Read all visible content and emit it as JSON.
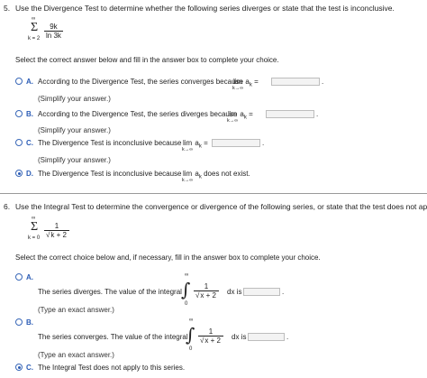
{
  "q5": {
    "number": "5.",
    "prompt": "Use the Divergence Test to determine whether the following series diverges or state that the test is inconclusive.",
    "series": {
      "sigma": "Σ",
      "upper": "∞",
      "lower": "k = 2",
      "numerator": "9k",
      "denominator": "ln 3k"
    },
    "instruction": "Select the correct answer below and fill in the answer box to complete your choice.",
    "options": [
      {
        "letter": "A.",
        "text": "According to the Divergence Test, the series converges because",
        "lim": "lim",
        "sub": "k→∞",
        "a": "a",
        "ak_sub": "k",
        "eq": "=",
        "hint": "(Simplify your answer.)",
        "selected": false
      },
      {
        "letter": "B.",
        "text": "According to the Divergence Test, the series diverges because",
        "lim": "lim",
        "sub": "k→∞",
        "a": "a",
        "ak_sub": "k",
        "eq": "=",
        "hint": "(Simplify your answer.)",
        "selected": false
      },
      {
        "letter": "C.",
        "text": "The Divergence Test is inconclusive because",
        "lim": "lim",
        "sub": "k→∞",
        "a": "a",
        "ak_sub": "k",
        "eq": "=",
        "hint": "(Simplify your answer.)",
        "selected": false
      },
      {
        "letter": "D.",
        "text": "The Divergence Test is inconclusive because",
        "lim": "lim",
        "sub": "k→∞",
        "a": "a",
        "ak_sub": "k",
        "tail": "does not exist.",
        "selected": true
      }
    ],
    "period": "."
  },
  "q6": {
    "number": "6.",
    "prompt": "Use the Integral Test to determine the convergence or divergence of the following series, or state that the test does not apply.",
    "series": {
      "sigma": "Σ",
      "upper": "∞",
      "lower": "k = 0",
      "numerator": "1",
      "denominator": "k + 2"
    },
    "instruction": "Select the correct choice below and, if necessary, fill in the answer box to complete your choice.",
    "options": [
      {
        "letter": "A.",
        "text": "The series diverges. The value of the integral",
        "int_upper": "∞",
        "int_lower": "0",
        "int_num": "1",
        "int_den": "x + 2",
        "dx": "dx is",
        "hint": "(Type an exact answer.)",
        "selected": false
      },
      {
        "letter": "B.",
        "text": "The series converges. The value of the integral",
        "int_upper": "∞",
        "int_lower": "0",
        "int_num": "1",
        "int_den": "x + 2",
        "dx": "dx is",
        "hint": "(Type an exact answer.)",
        "selected": false
      },
      {
        "letter": "C.",
        "text": "The Integral Test does not apply to this series.",
        "selected": true
      }
    ],
    "period": "."
  },
  "colors": {
    "accent": "#2a5bb5",
    "box_bg": "#f3f3f3",
    "box_border": "#bdbdbd"
  }
}
